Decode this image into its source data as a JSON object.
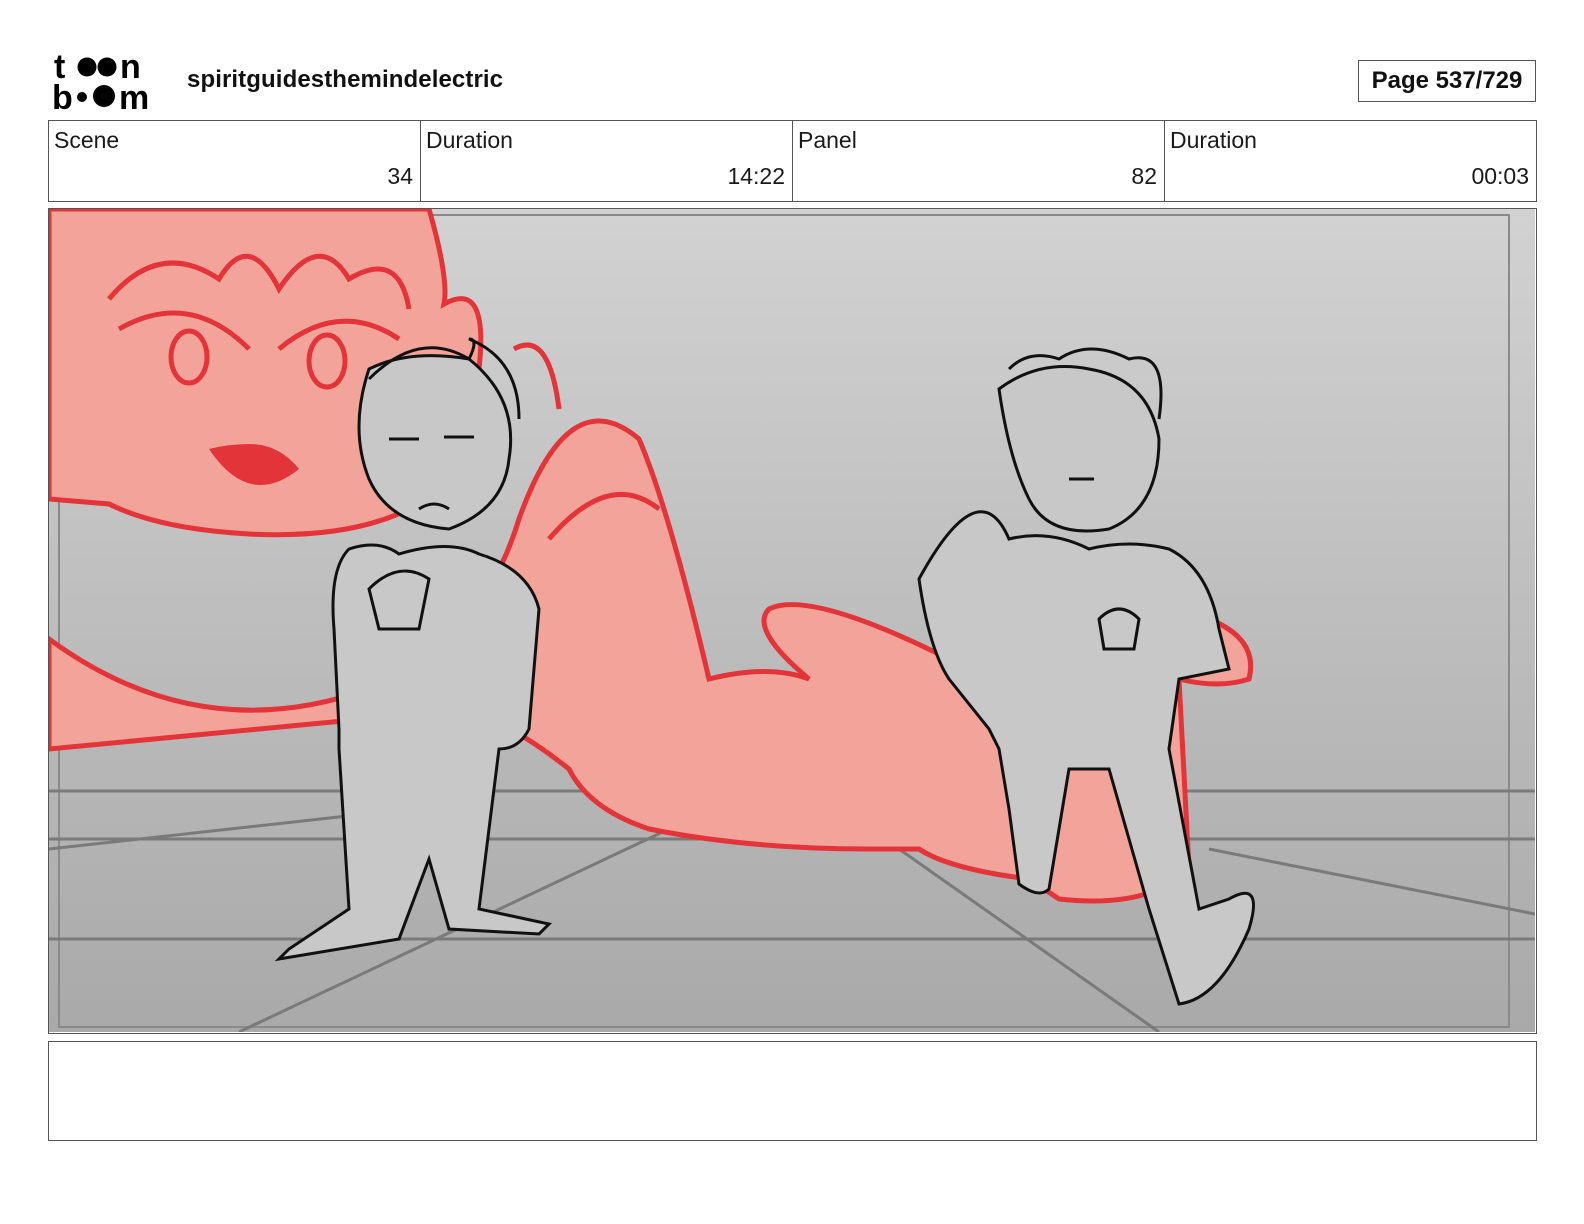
{
  "header": {
    "logo_text": "toon boom",
    "project_title": "spiritguidesthemindelectric",
    "page_label": "Page 537/729"
  },
  "info": {
    "scene_label": "Scene",
    "scene_value": "34",
    "scene_duration_label": "Duration",
    "scene_duration_value": "14:22",
    "panel_label": "Panel",
    "panel_value": "82",
    "panel_duration_label": "Duration",
    "panel_duration_value": "00:03"
  },
  "panel": {
    "sketch_colors": {
      "background_top": "#d2d2d2",
      "background_bottom": "#a9a9a9",
      "red_fill": "#f3a49a",
      "red_line": "#e3343a",
      "character_fill": "#c8c8c8",
      "character_line": "#111111"
    }
  },
  "notes": {
    "text": ""
  }
}
